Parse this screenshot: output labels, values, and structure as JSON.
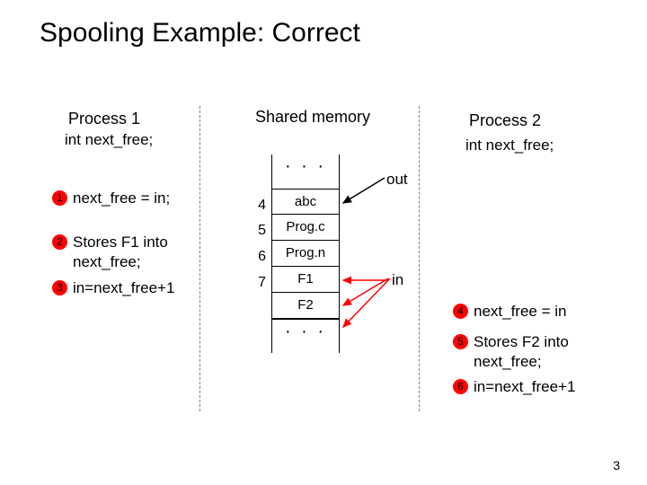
{
  "title": "Spooling Example: Correct",
  "proc1": {
    "header": "Process 1",
    "decl": "int next_free;",
    "steps": [
      {
        "n": "1",
        "text": "next_free = in;"
      },
      {
        "n": "2",
        "text": "Stores F1 into\nnext_free;"
      },
      {
        "n": "3",
        "text": "in=next_free+1"
      }
    ]
  },
  "shared": {
    "header": "Shared memory",
    "slots": [
      {
        "idx": "4",
        "val": "abc"
      },
      {
        "idx": "5",
        "val": "Prog.c"
      },
      {
        "idx": "6",
        "val": "Prog.n"
      },
      {
        "idx": "7",
        "val": "F1"
      }
    ],
    "extra_val": "F2",
    "out_label": "out",
    "in_label": "in"
  },
  "proc2": {
    "header": "Process 2",
    "decl": "int next_free;",
    "steps": [
      {
        "n": "4",
        "text": "next_free = in"
      },
      {
        "n": "5",
        "text": "Stores F2 into\nnext_free;"
      },
      {
        "n": "6",
        "text": "in=next_free+1"
      }
    ]
  },
  "page_number": "3"
}
